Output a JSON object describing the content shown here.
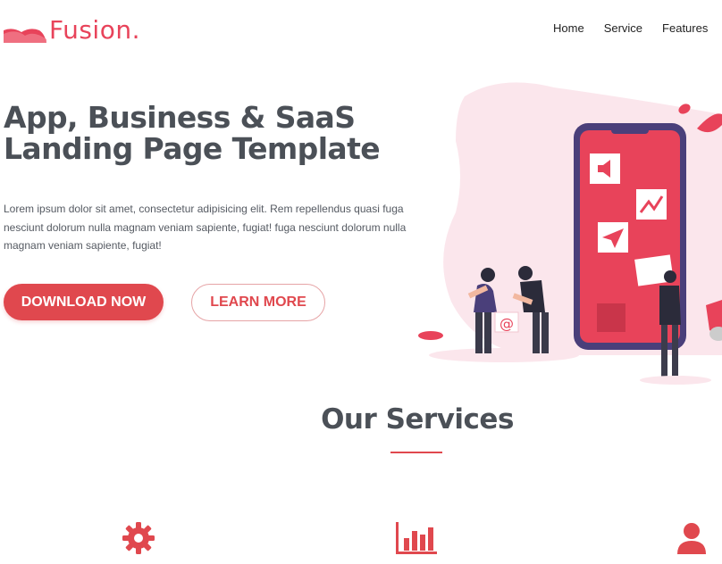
{
  "header": {
    "logo_text": "Fusion.",
    "nav": [
      "Home",
      "Service",
      "Features"
    ]
  },
  "hero": {
    "title_line1": "App, Business & SaaS",
    "title_line2": "Landing Page Template",
    "description": "Lorem ipsum dolor sit amet, consectetur adipisicing elit. Rem repellendus quasi fuga nesciunt dolorum nulla magnam veniam sapiente, fugiat! fuga nesciunt dolorum nulla magnam veniam sapiente, fugiat!",
    "primary_button": "DOWNLOAD NOW",
    "secondary_button": "LEARN MORE"
  },
  "services": {
    "title": "Our Services",
    "icons": [
      "gear-icon",
      "bar-chart-icon",
      "user-icon"
    ]
  },
  "colors": {
    "accent": "#e0484e",
    "brand": "#e8435a",
    "heading": "#4b5057",
    "phone_frame": "#4a3f7a",
    "blob": "#fbe6ec"
  }
}
